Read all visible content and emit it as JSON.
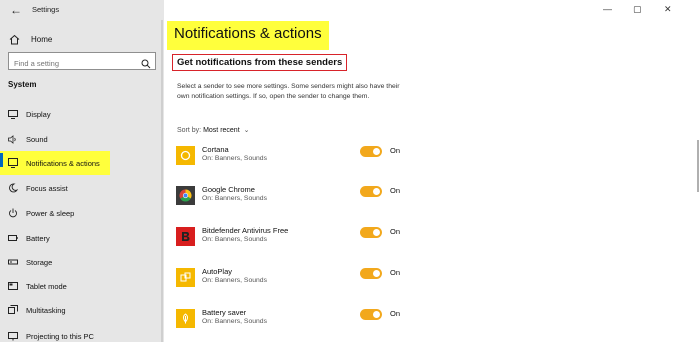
{
  "window": {
    "title": "Settings",
    "controls": {
      "minimize": "—",
      "restore": "▢",
      "close": "✕"
    }
  },
  "sidebar": {
    "home_label": "Home",
    "search_placeholder": "Find a setting",
    "section_label": "System",
    "items": [
      {
        "label": "Display",
        "icon": "display-icon"
      },
      {
        "label": "Sound",
        "icon": "sound-icon"
      },
      {
        "label": "Notifications & actions",
        "icon": "notifications-icon",
        "active": true
      },
      {
        "label": "Focus assist",
        "icon": "moon-icon"
      },
      {
        "label": "Power & sleep",
        "icon": "power-icon"
      },
      {
        "label": "Battery",
        "icon": "battery-icon"
      },
      {
        "label": "Storage",
        "icon": "storage-icon"
      },
      {
        "label": "Tablet mode",
        "icon": "tablet-icon"
      },
      {
        "label": "Multitasking",
        "icon": "multitasking-icon"
      },
      {
        "label": "Projecting to this PC",
        "icon": "projector-icon"
      }
    ]
  },
  "main": {
    "title": "Notifications & actions",
    "subtitle": "Get notifications from these senders",
    "description": "Select a sender to see more settings. Some senders might also have their own notification settings. If so, open the sender to change them.",
    "sort_label": "Sort by:",
    "sort_value": "Most recent",
    "senders": [
      {
        "name": "Cortana",
        "sub": "On: Banners, Sounds",
        "state": "On",
        "icon": "cortana-icon"
      },
      {
        "name": "Google Chrome",
        "sub": "On: Banners, Sounds",
        "state": "On",
        "icon": "chrome-icon"
      },
      {
        "name": "Bitdefender Antivirus Free",
        "sub": "On: Banners, Sounds",
        "state": "On",
        "icon": "bitdefender-icon"
      },
      {
        "name": "AutoPlay",
        "sub": "On: Banners, Sounds",
        "state": "On",
        "icon": "autoplay-icon"
      },
      {
        "name": "Battery saver",
        "sub": "On: Banners, Sounds",
        "state": "On",
        "icon": "battery-saver-icon"
      }
    ]
  },
  "colors": {
    "highlight": "#ffff3c",
    "accent_toggle": "#f2a81c",
    "callout_border": "#d8232a",
    "app_tile": "#f5b800"
  }
}
